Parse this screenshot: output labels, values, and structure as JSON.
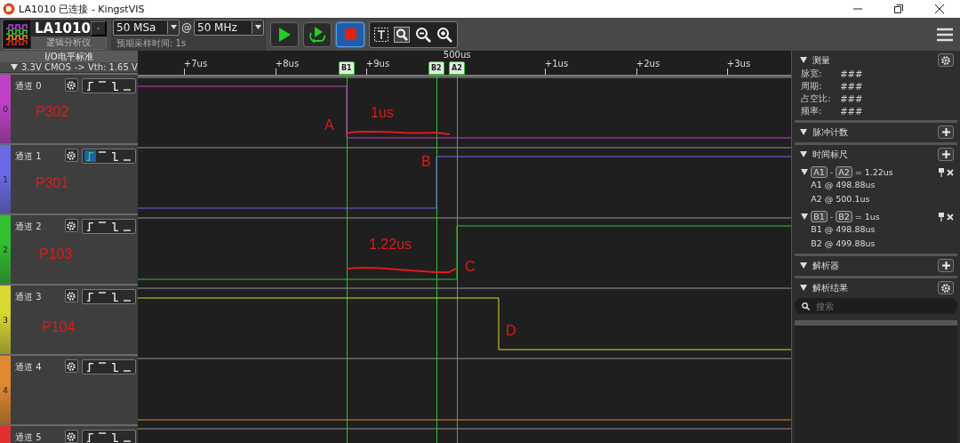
{
  "window": {
    "title": "LA1010 已连接 - KingstVIS"
  },
  "toolbar": {
    "device": "LA1010",
    "device_subtitle": "逻辑分析仪",
    "sample_rate": "50 MSa",
    "at": "@",
    "sample_freq": "50 MHz",
    "expected_time": "预期采样时间: 1s"
  },
  "io_standard": {
    "title": "I/O电平标准",
    "value": "3.3V CMOS",
    "threshold": "-> Vth: 1.65 V"
  },
  "ruler": {
    "ticks": [
      "+7us",
      "+8us",
      "+9us",
      "500us",
      "+1us",
      "+2us",
      "+3us"
    ]
  },
  "cursors": [
    {
      "label": "B1"
    },
    {
      "label": "B2"
    },
    {
      "label": "A2"
    }
  ],
  "channels": [
    {
      "name": "通道 0",
      "index": "0",
      "color": "#c040c8",
      "trigger_rising_selected": false
    },
    {
      "name": "通道 1",
      "index": "1",
      "color": "#6a6ae6",
      "trigger_rising_selected": true
    },
    {
      "name": "通道 2",
      "index": "2",
      "color": "#30c030",
      "trigger_rising_selected": false
    },
    {
      "name": "通道 3",
      "index": "3",
      "color": "#d8d830",
      "trigger_rising_selected": false
    },
    {
      "name": "通道 4",
      "index": "4",
      "color": "#e08a30",
      "trigger_rising_selected": false
    },
    {
      "name": "通道 5",
      "color": "#e03030",
      "trigger_rising_selected": false
    }
  ],
  "annotations": [
    {
      "text": "A"
    },
    {
      "text": "1us"
    },
    {
      "text": "B"
    },
    {
      "text": "1.22us"
    },
    {
      "text": "C"
    },
    {
      "text": "D"
    },
    {
      "text": "P302"
    },
    {
      "text": "P301"
    },
    {
      "text": "P103"
    },
    {
      "text": "P104"
    }
  ],
  "side_panel": {
    "sections": [
      {
        "title": "测量",
        "kind": "gear",
        "rows": [
          {
            "label": "脉宽:",
            "value": "###"
          },
          {
            "label": "周期:",
            "value": "###"
          },
          {
            "label": "占空比:",
            "value": "###"
          },
          {
            "label": "频率:",
            "value": "###"
          }
        ]
      },
      {
        "title": "脉冲计数",
        "kind": "plus"
      },
      {
        "title": "时间标尺",
        "kind": "plus",
        "pairs": [
          {
            "first": "A1",
            "separator": "-",
            "second": "A2",
            "delta": "= 1.22us",
            "lines": [
              "A1 @ 498.88us",
              "A2 @ 500.1us"
            ]
          },
          {
            "first": "B1",
            "separator": "-",
            "second": "B2",
            "delta": "= 1us",
            "lines": [
              "B1 @ 498.88us",
              "B2 @ 499.88us"
            ]
          }
        ]
      },
      {
        "title": "解析器",
        "kind": "plus"
      },
      {
        "title": "解析结果",
        "kind": "gear",
        "search_placeholder": "搜索"
      }
    ]
  }
}
